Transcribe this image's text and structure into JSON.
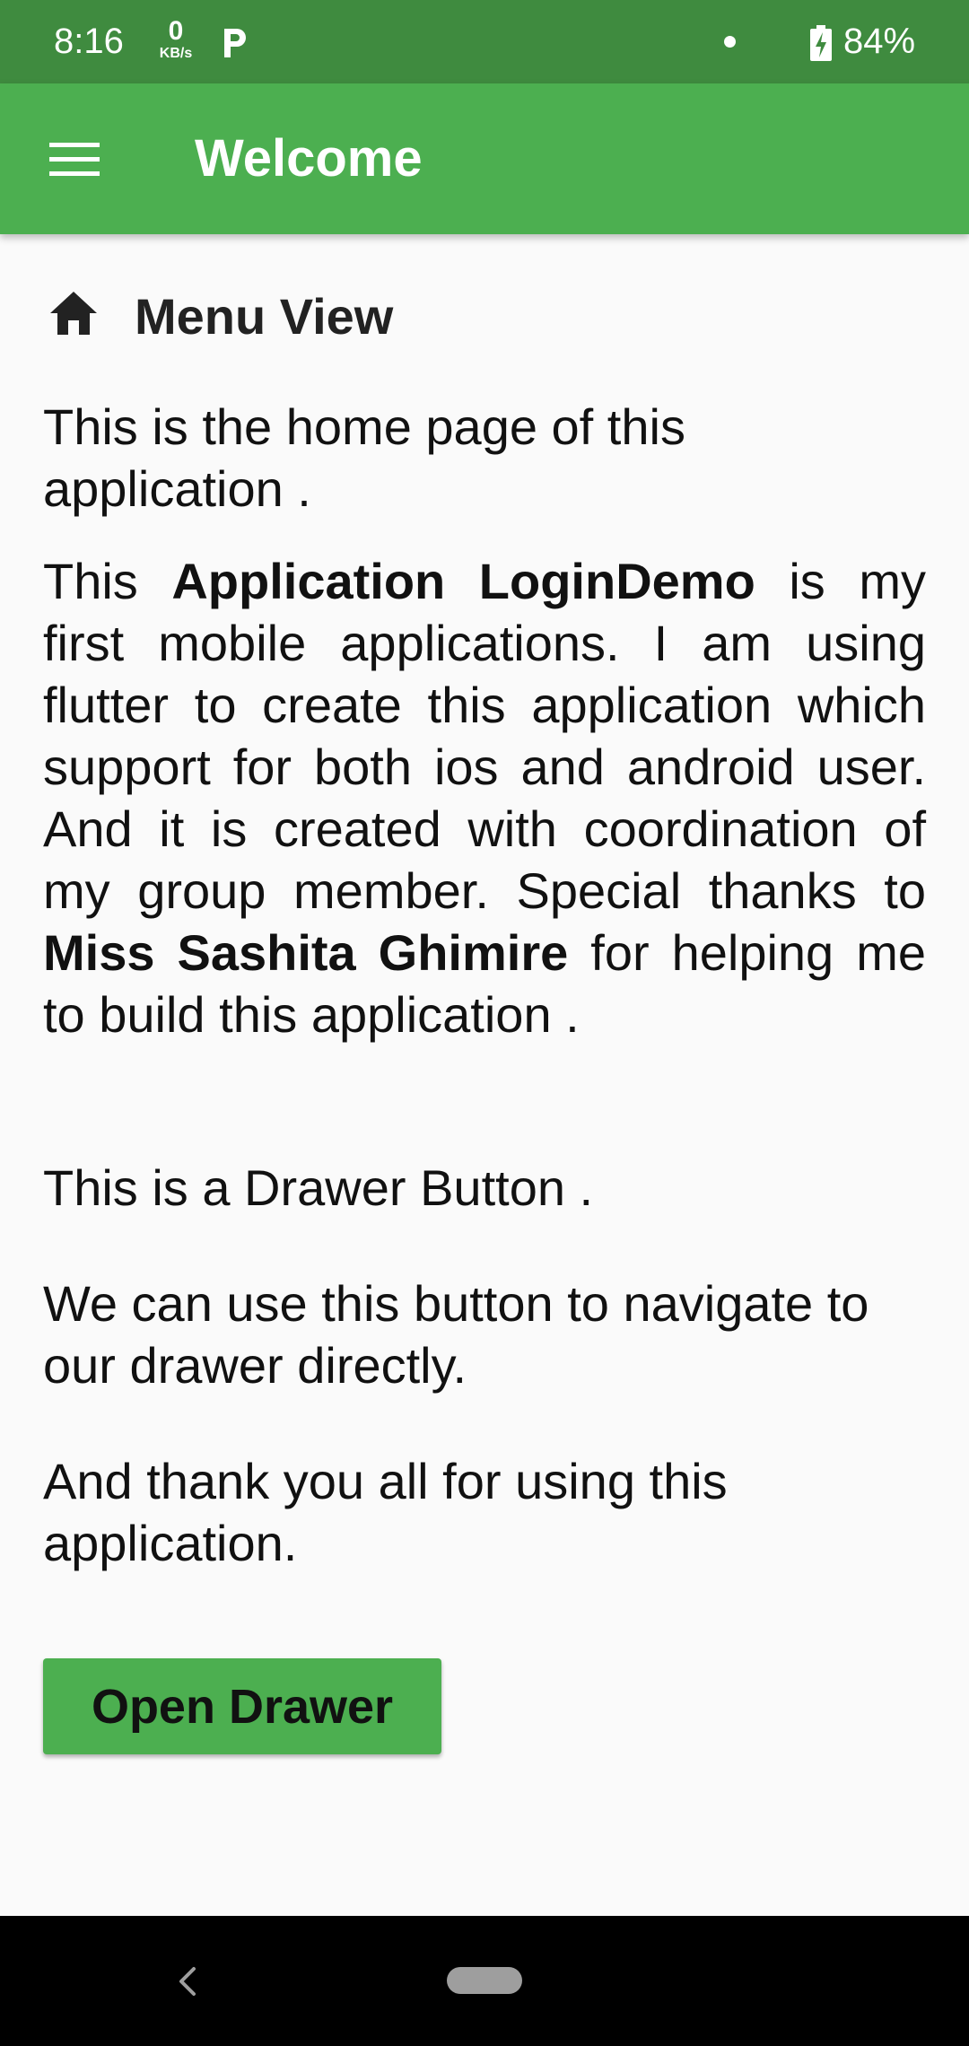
{
  "status_bar": {
    "time": "8:16",
    "speed_value": "0",
    "speed_unit": "KB/s",
    "battery": "84%",
    "icons": [
      "parking-p-icon",
      "notification-dot-icon",
      "battery-charging-icon"
    ]
  },
  "app_bar": {
    "title": "Welcome",
    "menu_icon": "hamburger-menu-icon",
    "color": "#4caf50"
  },
  "content": {
    "section_icon": "home-icon",
    "section_title": "Menu View",
    "intro": "This is the home page of this application .",
    "description": {
      "part1": "This ",
      "app_name": "Application LoginDemo",
      "part2": " is my first mobile applications. I am using flutter to create this application which support for both ios and android user. And it is created with coordination of my group member. Special thanks to  ",
      "person": "Miss Sashita Ghimire",
      "part3": " for helping me to build this application ."
    },
    "drawer_note": "This is a Drawer Button .",
    "navigate_note": "We can use this button to navigate to our drawer directly.",
    "thanks_note": "And thank you all for using this application."
  },
  "actions": {
    "open_drawer_label": "Open Drawer",
    "button_color": "#4caf50"
  },
  "nav_bar": {
    "back_icon": "back-chevron-icon",
    "home_icon": "home-pill-icon"
  }
}
